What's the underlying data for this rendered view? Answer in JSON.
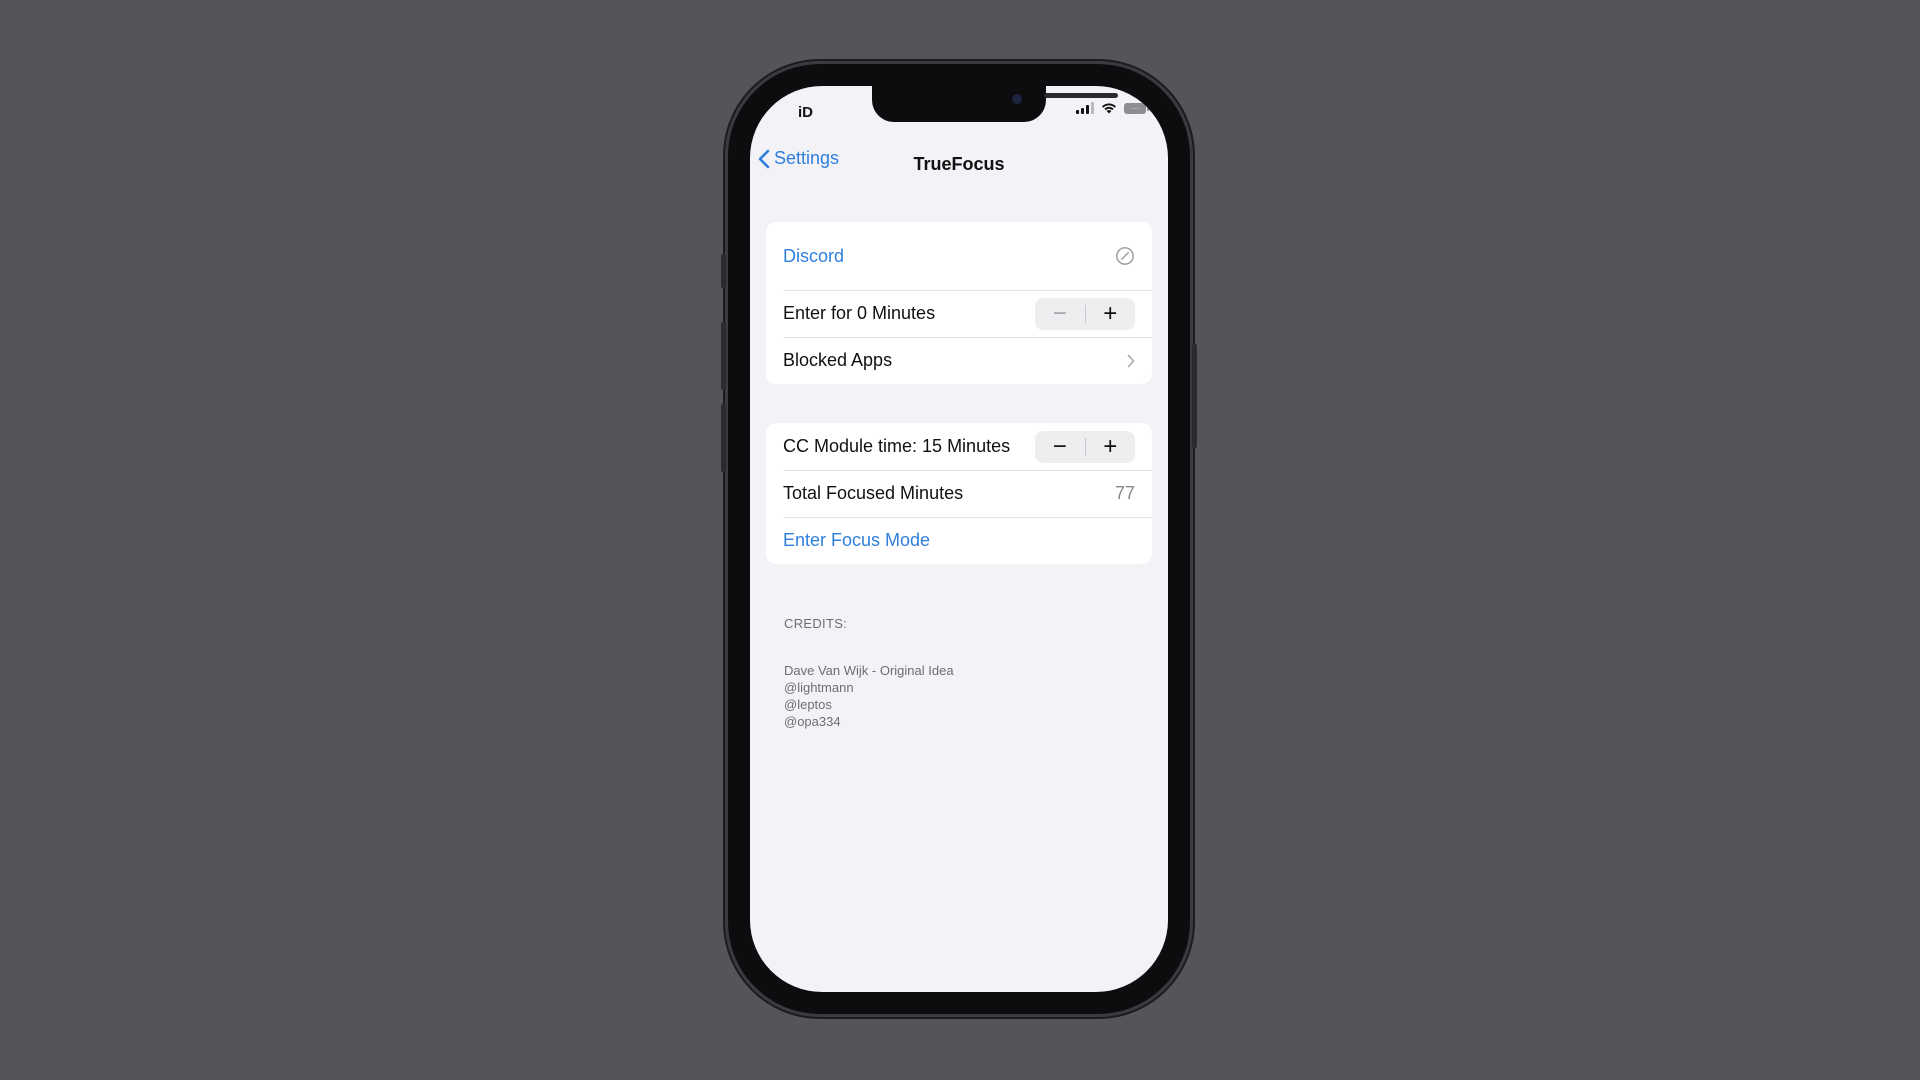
{
  "status_bar": {
    "carrier": "iD",
    "battery_label": "···"
  },
  "nav": {
    "back_label": "Settings",
    "title": "TrueFocus"
  },
  "group1": {
    "discord_label": "Discord",
    "enter_minutes_label": "Enter for 0 Minutes",
    "blocked_apps_label": "Blocked Apps"
  },
  "group2": {
    "cc_module_label": "CC Module time: 15 Minutes",
    "total_focused_label": "Total Focused Minutes",
    "total_focused_value": "77",
    "enter_focus_label": "Enter Focus Mode"
  },
  "stepper": {
    "minus": "−",
    "plus": "+"
  },
  "footer": {
    "credits_header": "CREDITS:",
    "credits_lines": [
      "Dave Van Wijk - Original Idea",
      "@lightmann",
      "@leptos",
      "@opa334"
    ]
  },
  "colors": {
    "accent": "#2f7fdc",
    "background": "#545559",
    "screen": "#f2f2f7"
  }
}
